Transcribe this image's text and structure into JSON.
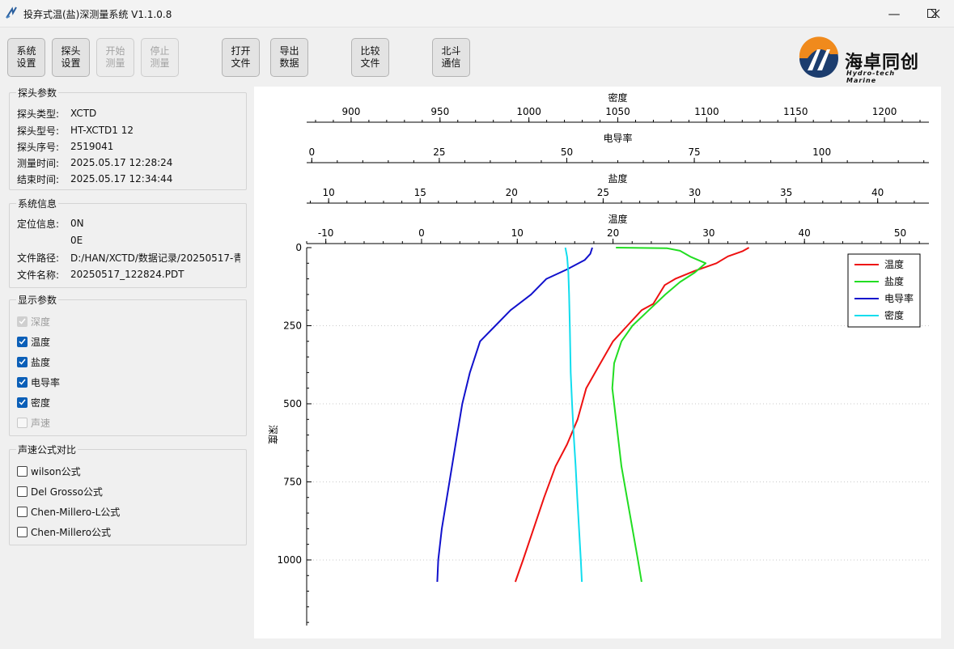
{
  "window": {
    "title": "投弃式温(盐)深测量系统 V1.1.0.8",
    "minimize_glyph": "—",
    "maximize_glyph": "☐",
    "close_glyph": "✕"
  },
  "toolbar": {
    "buttons": [
      {
        "label": "系统\n设置",
        "enabled": true
      },
      {
        "label": "探头\n设置",
        "enabled": true
      },
      {
        "label": "开始\n测量",
        "enabled": false
      },
      {
        "label": "停止\n测量",
        "enabled": false
      },
      {
        "label": "打开\n文件",
        "enabled": true
      },
      {
        "label": "导出\n数据",
        "enabled": true
      },
      {
        "label": "比较\n文件",
        "enabled": true
      },
      {
        "label": "北斗\n通信",
        "enabled": true
      }
    ]
  },
  "logo": {
    "name": "海卓同创",
    "subtitle": "Hydro-tech Marine",
    "icon": "hydro-tech-logo-icon"
  },
  "probe_params": {
    "title": "探头参数",
    "rows": [
      {
        "label": "探头类型:",
        "value": "XCTD"
      },
      {
        "label": "探头型号:",
        "value": "HT-XCTD1 12"
      },
      {
        "label": "探头序号:",
        "value": "2519041"
      },
      {
        "label": "测量时间:",
        "value": "2025.05.17 12:28:24"
      },
      {
        "label": "结束时间:",
        "value": "2025.05.17 12:34:44"
      }
    ]
  },
  "system_info": {
    "title": "系统信息",
    "position_label": "定位信息:",
    "lat": "0N",
    "lon": "0E",
    "path_label": "文件路径:",
    "path_value": "D:/HAN/XCTD/数据记录/20250517-青",
    "filename_label": "文件名称:",
    "filename_value": "20250517_122824.PDT"
  },
  "display_params": {
    "title": "显示参数",
    "items": [
      {
        "label": "深度",
        "checked": true,
        "enabled": false
      },
      {
        "label": "温度",
        "checked": true,
        "enabled": true
      },
      {
        "label": "盐度",
        "checked": true,
        "enabled": true
      },
      {
        "label": "电导率",
        "checked": true,
        "enabled": true
      },
      {
        "label": "密度",
        "checked": true,
        "enabled": true
      },
      {
        "label": "声速",
        "checked": false,
        "enabled": false
      }
    ]
  },
  "sound_formula": {
    "title": "声速公式对比",
    "items": [
      {
        "label": "wilson公式",
        "checked": false
      },
      {
        "label": "Del Grosso公式",
        "checked": false
      },
      {
        "label": "Chen-Millero-L公式",
        "checked": false
      },
      {
        "label": "Chen-Millero公式",
        "checked": false
      }
    ]
  },
  "chart_data": {
    "type": "line",
    "y_label": "深度",
    "y_range": [
      0,
      1210
    ],
    "y_inverted": true,
    "y_ticks": [
      "0",
      "250",
      "500",
      "750",
      "1000"
    ],
    "grid": "horizontal dotted",
    "legend_position": "top-right",
    "top_axes": [
      {
        "label": "密度",
        "range": [
          875,
          1225
        ],
        "ticks": [
          "900",
          "950",
          "1000",
          "1050",
          "1100",
          "1150",
          "1200"
        ]
      },
      {
        "label": "电导率",
        "range": [
          -1,
          121
        ],
        "ticks": [
          "0",
          "25",
          "50",
          "75",
          "100"
        ]
      },
      {
        "label": "盐度",
        "range": [
          8.8,
          42.8
        ],
        "ticks": [
          "10",
          "15",
          "20",
          "25",
          "30",
          "35",
          "40"
        ]
      },
      {
        "label": "温度",
        "range": [
          -12,
          53
        ],
        "ticks": [
          "-10",
          "0",
          "10",
          "20",
          "30",
          "40",
          "50"
        ]
      }
    ],
    "series": [
      {
        "name": "温度",
        "axis": 3,
        "color": "#ee1111",
        "points": [
          [
            34.2,
            0
          ],
          [
            33.5,
            12
          ],
          [
            32,
            28
          ],
          [
            30.8,
            50
          ],
          [
            28.5,
            75
          ],
          [
            26.5,
            100
          ],
          [
            25.4,
            120
          ],
          [
            24.8,
            150
          ],
          [
            24.2,
            180
          ],
          [
            23,
            200
          ],
          [
            21.5,
            250
          ],
          [
            20,
            300
          ],
          [
            18.5,
            380
          ],
          [
            17.2,
            450
          ],
          [
            16.3,
            550
          ],
          [
            15.2,
            630
          ],
          [
            14,
            700
          ],
          [
            12.8,
            800
          ],
          [
            11.7,
            900
          ],
          [
            10.6,
            1000
          ],
          [
            9.8,
            1070
          ]
        ]
      },
      {
        "name": "盐度",
        "axis": 2,
        "color": "#22dd22",
        "points": [
          [
            25.7,
            0
          ],
          [
            28.5,
            2
          ],
          [
            29.2,
            10
          ],
          [
            29.8,
            30
          ],
          [
            30.6,
            50
          ],
          [
            30,
            80
          ],
          [
            29.2,
            110
          ],
          [
            28.4,
            150
          ],
          [
            27.5,
            200
          ],
          [
            26.6,
            250
          ],
          [
            26,
            300
          ],
          [
            25.6,
            370
          ],
          [
            25.5,
            450
          ],
          [
            25.6,
            500
          ],
          [
            25.8,
            600
          ],
          [
            26,
            700
          ],
          [
            26.3,
            800
          ],
          [
            26.6,
            900
          ],
          [
            26.9,
            1000
          ],
          [
            27.1,
            1070
          ]
        ]
      },
      {
        "name": "电导率",
        "axis": 1,
        "color": "#1111cc",
        "points": [
          [
            55,
            0
          ],
          [
            54.6,
            20
          ],
          [
            53.5,
            40
          ],
          [
            50,
            70
          ],
          [
            46,
            100
          ],
          [
            43,
            150
          ],
          [
            39,
            200
          ],
          [
            36,
            250
          ],
          [
            33,
            300
          ],
          [
            31,
            400
          ],
          [
            29.5,
            500
          ],
          [
            28.5,
            600
          ],
          [
            27.5,
            700
          ],
          [
            26.5,
            800
          ],
          [
            25.5,
            900
          ],
          [
            24.8,
            1000
          ],
          [
            24.6,
            1070
          ]
        ]
      },
      {
        "name": "密度",
        "axis": 0,
        "color": "#11ddee",
        "points": [
          [
            1020.5,
            0
          ],
          [
            1021.5,
            30
          ],
          [
            1022.2,
            80
          ],
          [
            1022.6,
            150
          ],
          [
            1023,
            250
          ],
          [
            1023.5,
            400
          ],
          [
            1024.3,
            500
          ],
          [
            1025.2,
            600
          ],
          [
            1026.3,
            700
          ],
          [
            1027.2,
            800
          ],
          [
            1028.2,
            900
          ],
          [
            1029.2,
            1000
          ],
          [
            1029.8,
            1070
          ]
        ]
      }
    ]
  }
}
